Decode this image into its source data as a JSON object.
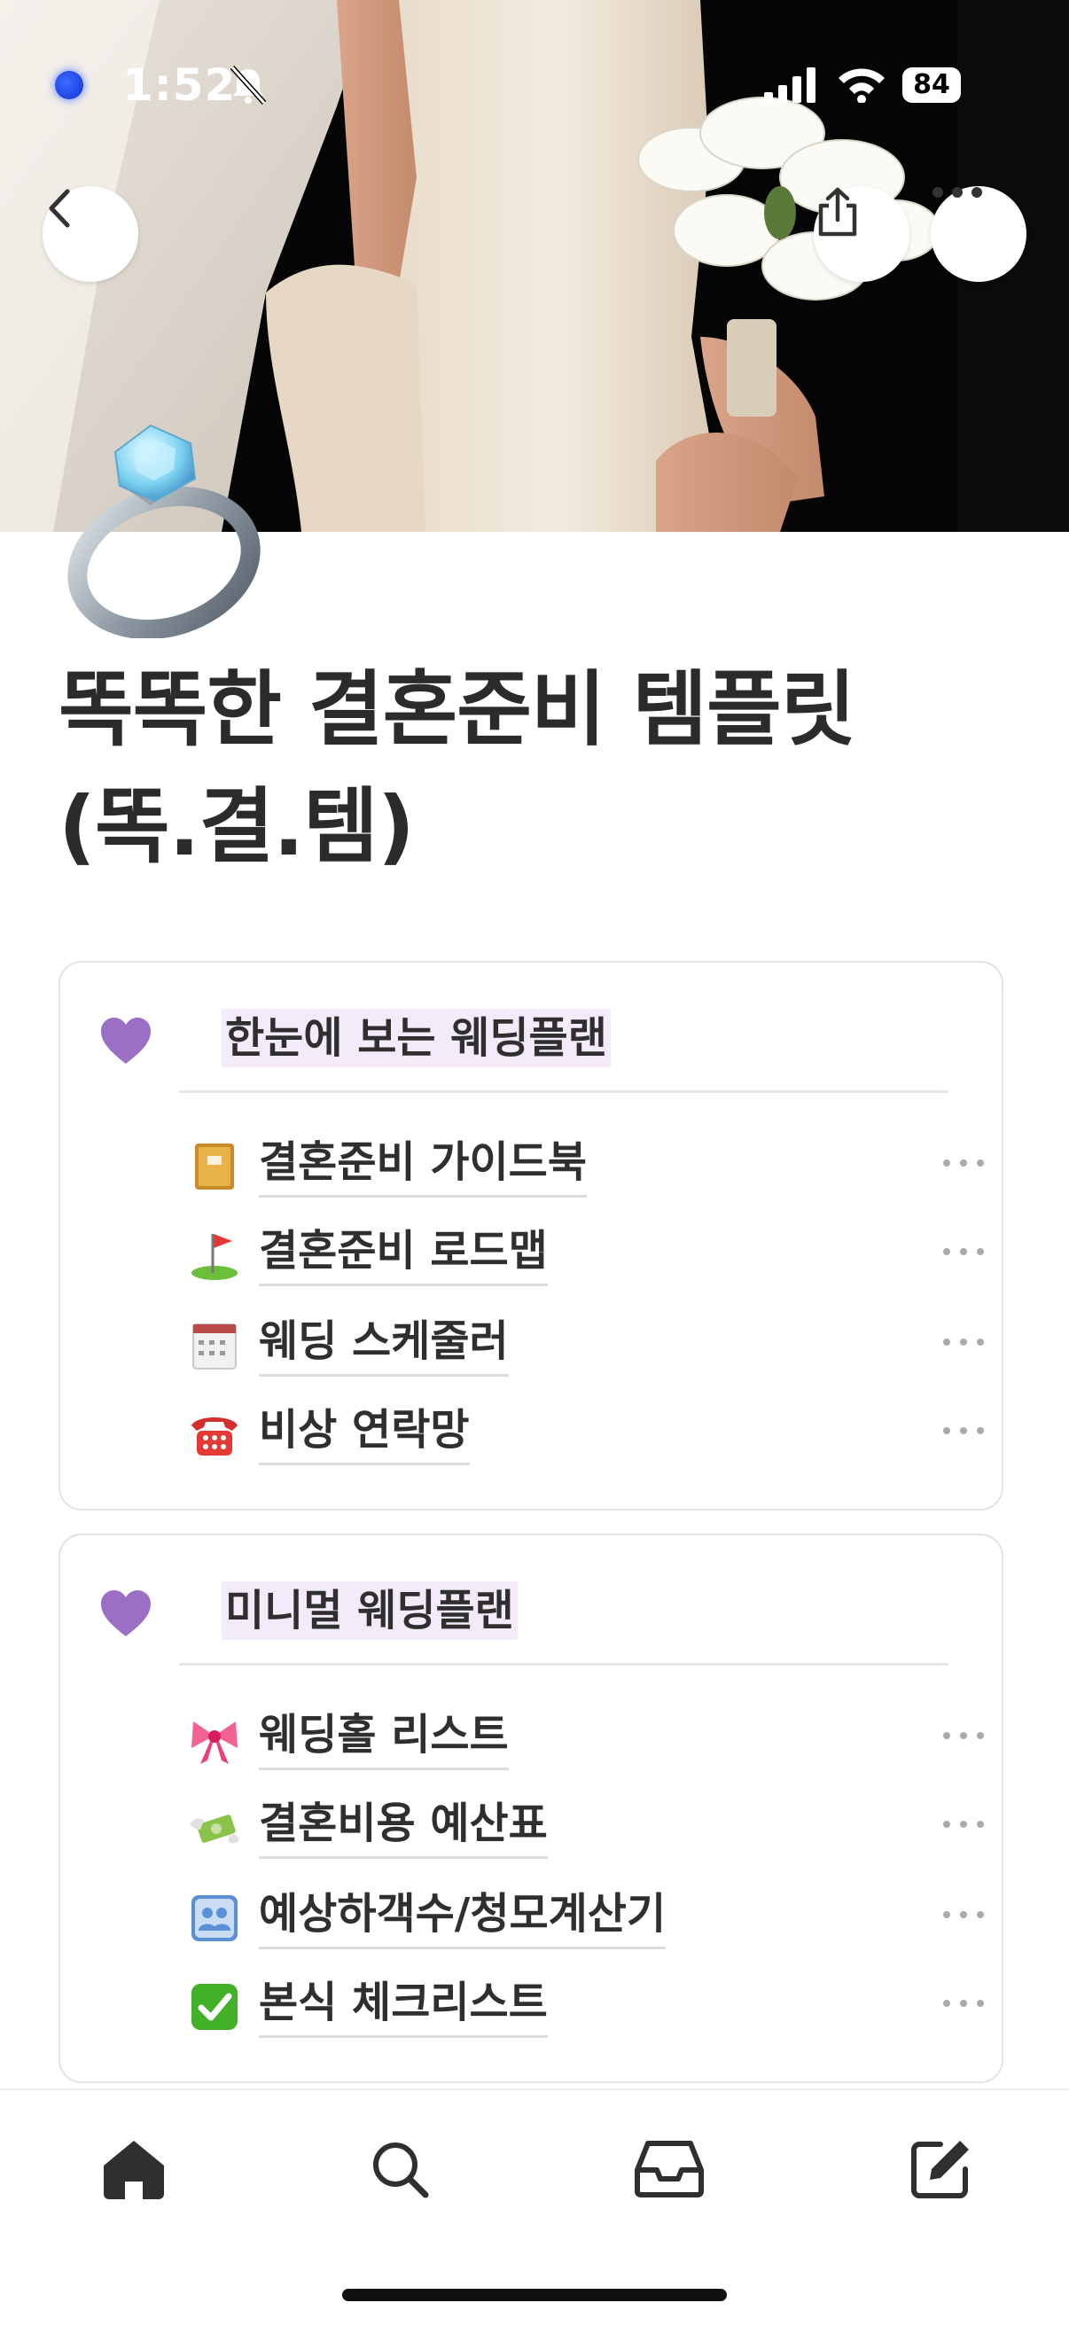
{
  "status_bar": {
    "time": "1:52",
    "battery": "84"
  },
  "page": {
    "title_line1": "똑똑한 결혼준비 템플릿",
    "title_line2": "(똑.결.템)"
  },
  "sections": [
    {
      "title": "한눈에 보는 웨딩플랜",
      "items": [
        {
          "label": "결혼준비 가이드북",
          "icon": "ledger-book-icon"
        },
        {
          "label": "결혼준비 로드맵",
          "icon": "golf-flag-icon"
        },
        {
          "label": "웨딩 스케줄러",
          "icon": "calendar-pad-icon"
        },
        {
          "label": "비상 연락망",
          "icon": "telephone-icon"
        }
      ]
    },
    {
      "title": "미니멀 웨딩플랜",
      "items": [
        {
          "label": "웨딩홀 리스트",
          "icon": "ribbon-icon"
        },
        {
          "label": "결혼비용 예산표",
          "icon": "money-wings-icon"
        },
        {
          "label": "예상하객수/청모계산기",
          "icon": "people-icon"
        },
        {
          "label": "본식 체크리스트",
          "icon": "check-mark-icon"
        }
      ]
    }
  ],
  "colors": {
    "heart": "#9b6fc4",
    "title_highlight": "#f3ebfa",
    "text": "#2f2f2f"
  }
}
